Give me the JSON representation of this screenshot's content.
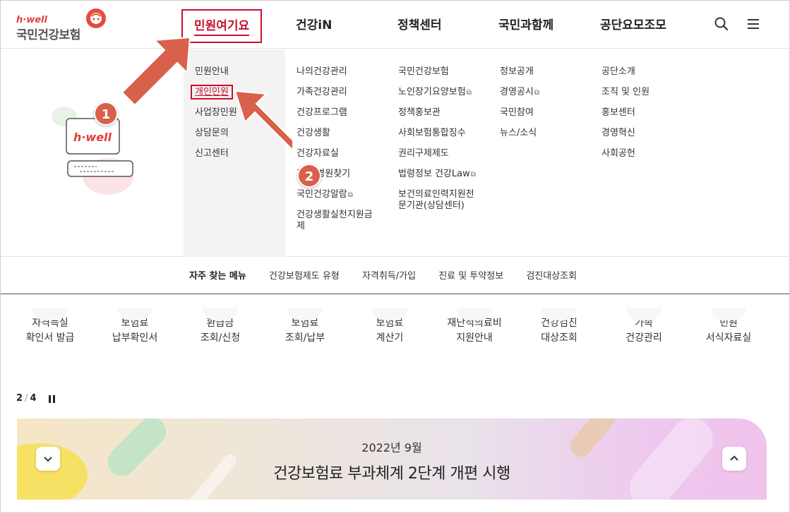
{
  "logo": {
    "top": "h·well",
    "main": "국민건강보험"
  },
  "gnb": {
    "items": [
      "민원여기요",
      "건강iN",
      "정책센터",
      "국민과함께",
      "공단요모조모"
    ]
  },
  "menu": {
    "col1": [
      "민원안내",
      "개인민원",
      "사업장민원",
      "상담문의",
      "신고센터"
    ],
    "col2": [
      "나의건강관리",
      "가족건강관리",
      "건강프로그램",
      "건강생활",
      "건강자료실",
      "기관/병원찾기",
      "국민건강알람",
      "건강생활실천지원금제"
    ],
    "col3": [
      "국민건강보험",
      "노인장기요양보험",
      "정책홍보관",
      "사회보험통합징수",
      "권리구제제도",
      "법령정보 건강Law",
      "보건의료인력지원전문기관(상담센터)"
    ],
    "col4": [
      "정보공개",
      "경영공시",
      "국민참여",
      "뉴스/소식"
    ],
    "col5": [
      "공단소개",
      "조직 및 인원",
      "홍보센터",
      "경영혁신",
      "사회공헌"
    ],
    "ext_mark": "⧉"
  },
  "illustration": {
    "label": "h·well"
  },
  "markers": [
    "1",
    "2"
  ],
  "quick": {
    "title": "자주 찾는 메뉴",
    "links": [
      "건강보험제도 유형",
      "자격취득/가입",
      "진료 및 투약정보",
      "검진대상조회"
    ]
  },
  "shortcuts": [
    [
      "자격득실",
      "확인서 발급"
    ],
    [
      "보험료",
      "납부확인서"
    ],
    [
      "환급금",
      "조회/신청"
    ],
    [
      "보험료",
      "조회/납부"
    ],
    [
      "보험료",
      "계산기"
    ],
    [
      "재난적의료비",
      "지원안내"
    ],
    [
      "건강검진",
      "대상조회"
    ],
    [
      "가족",
      "건강관리"
    ],
    [
      "민원",
      "서식자료실"
    ]
  ],
  "pager": {
    "current": "2",
    "total": "4"
  },
  "banner": {
    "sub": "2022년 9월",
    "title": "건강보험료 부과체계 2단계 개편 시행"
  },
  "colors": {
    "brand_red": "#c8102e",
    "arrow": "#d9604a"
  }
}
